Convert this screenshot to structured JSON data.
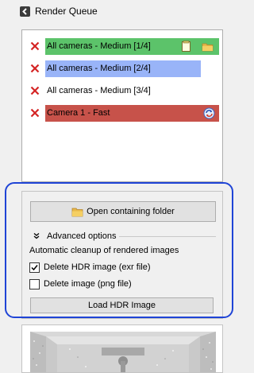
{
  "window": {
    "title": "Render Queue",
    "back_icon": "back-arrow-icon"
  },
  "queue": {
    "items": [
      {
        "label": "All cameras - Medium [1/4]",
        "color": "#5cc36a",
        "icons": [
          "document-icon",
          "folder-icon"
        ]
      },
      {
        "label": "All cameras - Medium [2/4]",
        "color": "#99b4f8",
        "icons": []
      },
      {
        "label": "All cameras - Medium [3/4]",
        "color": "#ffffff",
        "icons": []
      },
      {
        "label": "Camera 1 - Fast",
        "color": "#c7524a",
        "icons": [
          "refresh-icon"
        ]
      }
    ]
  },
  "panel": {
    "open_folder_label": "Open containing folder",
    "advanced_label": "Advanced options",
    "cleanup_label": "Automatic cleanup of rendered images",
    "delete_hdr_label": "Delete HDR image (exr file)",
    "delete_hdr_checked": true,
    "delete_png_label": "Delete image (png file)",
    "delete_png_checked": false,
    "load_hdr_label": "Load HDR Image"
  },
  "colors": {
    "highlight": "#1f44d6",
    "remove_x": "#d42424"
  }
}
